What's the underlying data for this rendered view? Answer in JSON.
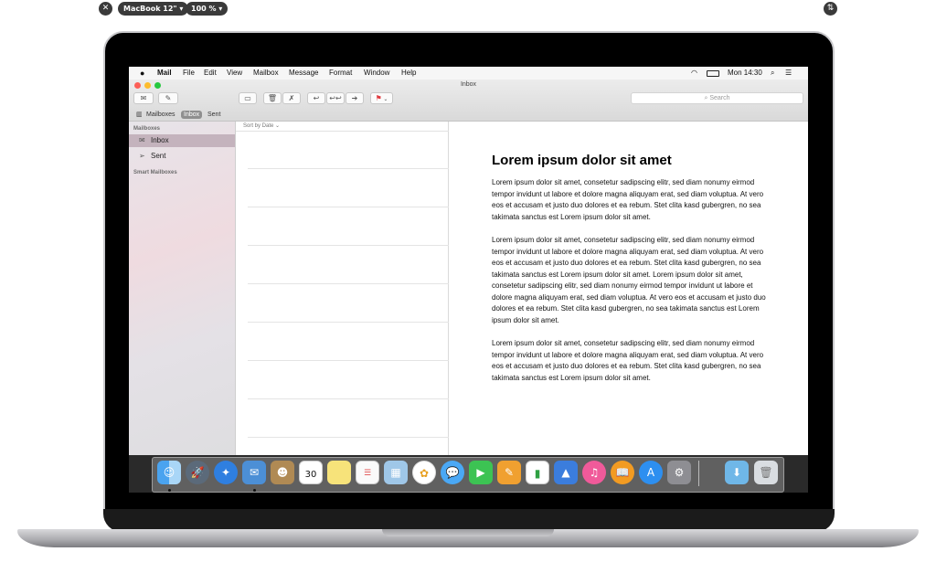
{
  "preview": {
    "device": "MacBook 12\" ▾",
    "zoom": "100 % ▾"
  },
  "menubar": {
    "app": "Mail",
    "items": [
      "File",
      "Edit",
      "View",
      "Mailbox",
      "Message",
      "Format",
      "Window",
      "Help"
    ],
    "clock": "Mon 14:30"
  },
  "window": {
    "title": "Inbox",
    "search_placeholder": "Search"
  },
  "favorites": {
    "mailboxes": "Mailboxes",
    "inbox": "Inbox",
    "sent": "Sent"
  },
  "sidebar": {
    "mailboxes_header": "Mailboxes",
    "items": [
      {
        "label": "Inbox"
      },
      {
        "label": "Sent"
      }
    ],
    "smart_header": "Smart Mailboxes"
  },
  "message_list": {
    "sort_label": "Sort by Date ⌄"
  },
  "message": {
    "subject": "Lorem ipsum dolor sit amet",
    "paragraphs": [
      "Lorem ipsum dolor sit amet, consetetur sadipscing elitr, sed diam nonumy eirmod tempor invidunt ut labore et dolore magna aliquyam erat, sed diam voluptua. At vero eos et accusam et justo duo dolores et ea rebum. Stet clita kasd gubergren, no sea takimata sanctus est Lorem ipsum dolor sit amet.",
      "Lorem ipsum dolor sit amet, consetetur sadipscing elitr, sed diam nonumy eirmod tempor invidunt ut labore et dolore magna aliquyam erat, sed diam voluptua. At vero eos et accusam et justo duo dolores et ea rebum. Stet clita kasd gubergren, no sea takimata sanctus est Lorem ipsum dolor sit amet. Lorem ipsum dolor sit amet, consetetur sadipscing elitr, sed diam nonumy eirmod tempor invidunt ut labore et dolore magna aliquyam erat, sed diam voluptua. At vero eos et accusam et justo duo dolores et ea rebum. Stet clita kasd gubergren, no sea takimata sanctus est Lorem ipsum dolor sit amet.",
      "Lorem ipsum dolor sit amet, consetetur sadipscing elitr, sed diam nonumy eirmod tempor invidunt ut labore et dolore magna aliquyam erat, sed diam voluptua. At vero eos et accusam et justo duo dolores et ea rebum. Stet clita kasd gubergren, no sea takimata sanctus est Lorem ipsum dolor sit amet."
    ]
  },
  "dock": {
    "calendar_day": "30",
    "apps": [
      "finder-icon",
      "launchpad-icon",
      "safari-icon",
      "mail-icon",
      "contacts-icon",
      "calendar-icon",
      "notes-icon",
      "reminders-icon",
      "photo-booth-icon",
      "photos-icon",
      "messages-icon",
      "facetime-icon",
      "pages-icon",
      "numbers-icon",
      "keynote-icon",
      "itunes-icon",
      "ibooks-icon",
      "app-store-icon",
      "system-preferences-icon",
      "downloads-folder-icon",
      "trash-icon"
    ]
  },
  "colors": {
    "sidebar_selected": "#c4b3bd",
    "flag_red": "#e0393e"
  }
}
